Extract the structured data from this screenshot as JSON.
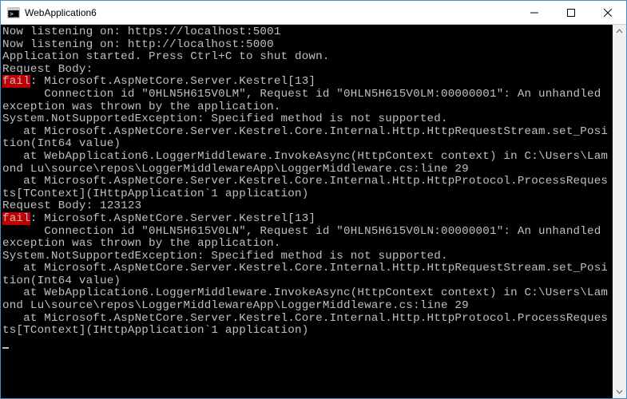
{
  "window": {
    "title": "WebApplication6",
    "icon": "console-icon"
  },
  "controls": {
    "minimize": "—",
    "maximize": "☐",
    "close": "✕"
  },
  "console": {
    "fail_label": "fail",
    "lines_pre1": "Now listening on: https://localhost:5001\nNow listening on: http://localhost:5000\nApplication started. Press Ctrl+C to shut down.\nRequest Body:",
    "fail1_rest": ": Microsoft.AspNetCore.Server.Kestrel[13]",
    "block1": "      Connection id \"0HLN5H615V0LM\", Request id \"0HLN5H615V0LM:00000001\": An unhandled exception was thrown by the application.\nSystem.NotSupportedException: Specified method is not supported.\n   at Microsoft.AspNetCore.Server.Kestrel.Core.Internal.Http.HttpRequestStream.set_Position(Int64 value)\n   at WebApplication6.LoggerMiddleware.InvokeAsync(HttpContext context) in C:\\Users\\Lamond Lu\\source\\repos\\LoggerMiddlewareApp\\LoggerMiddleware.cs:line 29\n   at Microsoft.AspNetCore.Server.Kestrel.Core.Internal.Http.HttpProtocol.ProcessRequests[TContext](IHttpApplication`1 application)\nRequest Body: 123123",
    "fail2_rest": ": Microsoft.AspNetCore.Server.Kestrel[13]",
    "block2": "      Connection id \"0HLN5H615V0LN\", Request id \"0HLN5H615V0LN:00000001\": An unhandled exception was thrown by the application.\nSystem.NotSupportedException: Specified method is not supported.\n   at Microsoft.AspNetCore.Server.Kestrel.Core.Internal.Http.HttpRequestStream.set_Position(Int64 value)\n   at WebApplication6.LoggerMiddleware.InvokeAsync(HttpContext context) in C:\\Users\\Lamond Lu\\source\\repos\\LoggerMiddlewareApp\\LoggerMiddleware.cs:line 29\n   at Microsoft.AspNetCore.Server.Kestrel.Core.Internal.Http.HttpProtocol.ProcessRequests[TContext](IHttpApplication`1 application)"
  }
}
